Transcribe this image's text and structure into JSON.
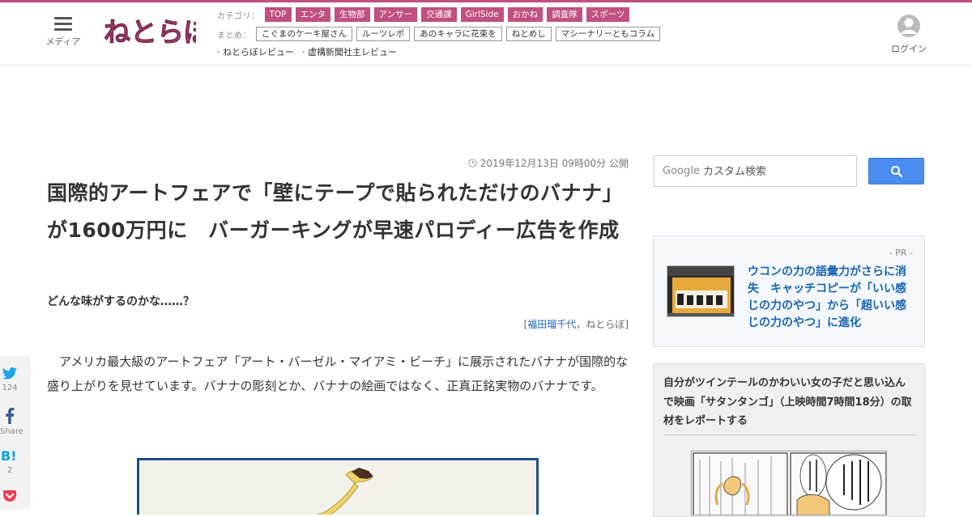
{
  "header": {
    "menu_label": "メディア",
    "logo_text": "ねとらぼ",
    "category_label": "カテゴリ：",
    "categories": [
      "TOP",
      "エンタ",
      "生物部",
      "アンサー",
      "交通課",
      "GirlSide",
      "おかね",
      "調査隊",
      "スポーツ"
    ],
    "matome_label": "まとめ：",
    "matome": [
      "こぐまのケーキ屋さん",
      "ルーツレポ",
      "あのキャラに花束を",
      "ねとめし",
      "マシーナリーともコラム"
    ],
    "reviews": [
      "· ねとらぼレビュー",
      "· 虚構新聞社主レビュー"
    ],
    "login_label": "ログイン",
    "accent_color": "#c0507f"
  },
  "article": {
    "timestamp": "2019年12月13日 09時00分 公開",
    "headline": "国際的アートフェアで「壁にテープで貼られただけのバナナ」が1600万円に　バーガーキングが早速パロディー広告を作成",
    "subtitle": "どんな味がするのかな……？",
    "author": "福田瑠千代",
    "byline_open": "[",
    "byline_sep": "，",
    "publisher": "ねとらぼ",
    "byline_close": "]",
    "body": "アメリカ最大級のアートフェア「アート・バーゼル・マイアミ・ビーチ」に展示されたバナナが国際的な盛り上がりを見せています。バナナの彫刻とか、バナナの絵画ではなく、正真正銘実物のバナナです。"
  },
  "share": {
    "twitter_count": "124",
    "facebook_label": "Share",
    "hatena_count": "2",
    "icons": [
      "twitter-icon",
      "facebook-icon",
      "hatena-icon",
      "pocket-icon"
    ]
  },
  "sidebar": {
    "search_watermark": "Google",
    "search_placeholder": "カスタム検索",
    "pr_label": "- PR -",
    "pr_title": "ウコンの力の語彙力がさらに消失　キャッチコピーが「いい感じの力のやつ」から「超いい感じの力のやつ」に進化",
    "featured_title": "自分がツインテールのかわいい女の子だと思い込んで映画「サタンタンゴ」（上映時間7時間18分）の取材をレポートする",
    "link_color": "#1a64b4"
  }
}
